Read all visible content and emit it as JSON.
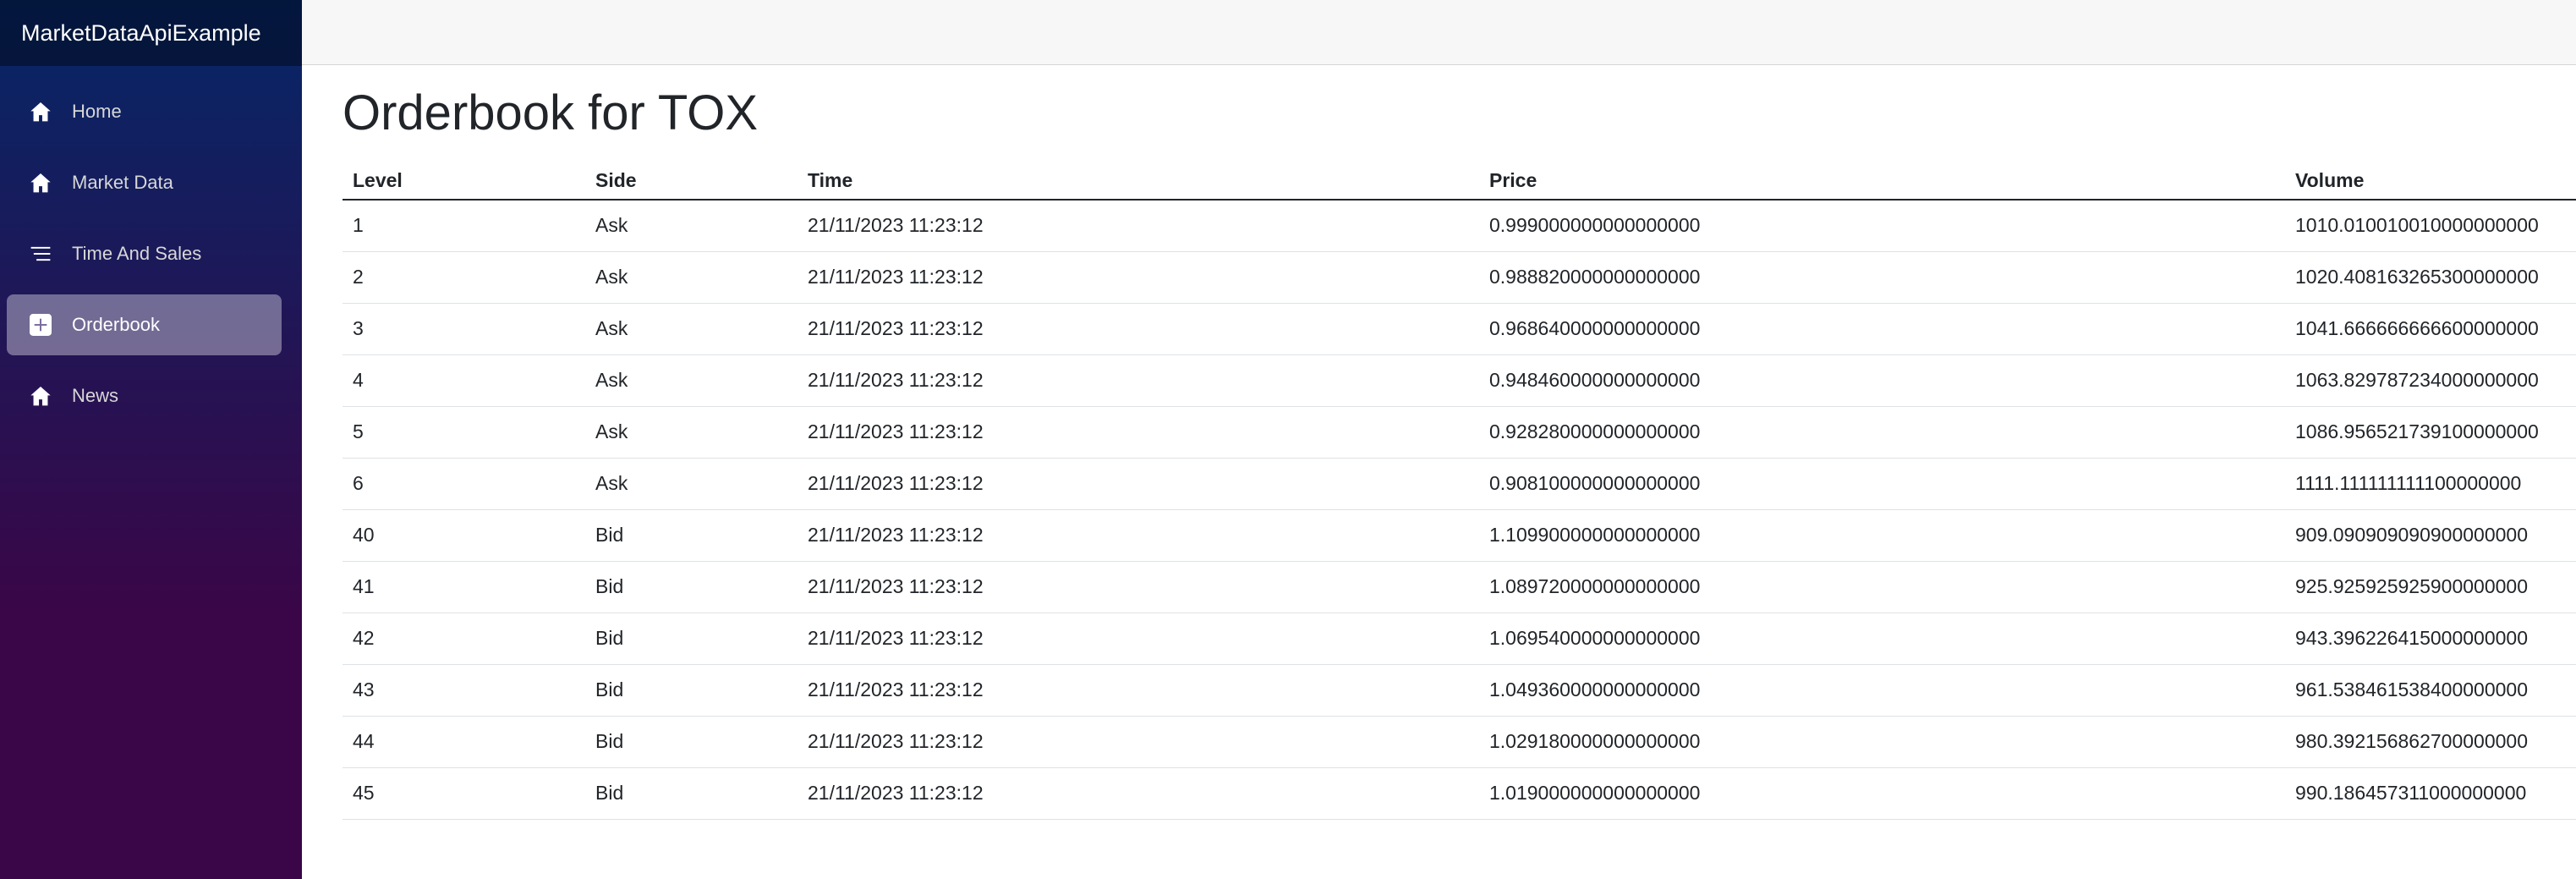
{
  "app": {
    "brand": "MarketDataApiExample"
  },
  "nav": {
    "items": [
      {
        "label": "Home",
        "icon": "home-icon",
        "active": false
      },
      {
        "label": "Market Data",
        "icon": "home-icon",
        "active": false
      },
      {
        "label": "Time And Sales",
        "icon": "list-icon",
        "active": false
      },
      {
        "label": "Orderbook",
        "icon": "plus-square-icon",
        "active": true
      },
      {
        "label": "News",
        "icon": "home-icon",
        "active": false
      }
    ]
  },
  "page": {
    "title": "Orderbook for TOX"
  },
  "table": {
    "columns": [
      "Level",
      "Side",
      "Time",
      "Price",
      "Volume"
    ],
    "rows": [
      [
        "1",
        "Ask",
        "21/11/2023 11:23:12",
        "0.999000000000000000",
        "1010.010010010000000000"
      ],
      [
        "2",
        "Ask",
        "21/11/2023 11:23:12",
        "0.988820000000000000",
        "1020.408163265300000000"
      ],
      [
        "3",
        "Ask",
        "21/11/2023 11:23:12",
        "0.968640000000000000",
        "1041.666666666600000000"
      ],
      [
        "4",
        "Ask",
        "21/11/2023 11:23:12",
        "0.948460000000000000",
        "1063.829787234000000000"
      ],
      [
        "5",
        "Ask",
        "21/11/2023 11:23:12",
        "0.928280000000000000",
        "1086.956521739100000000"
      ],
      [
        "6",
        "Ask",
        "21/11/2023 11:23:12",
        "0.908100000000000000",
        "1111.111111111100000000"
      ],
      [
        "40",
        "Bid",
        "21/11/2023 11:23:12",
        "1.109900000000000000",
        "909.090909090900000000"
      ],
      [
        "41",
        "Bid",
        "21/11/2023 11:23:12",
        "1.089720000000000000",
        "925.925925925900000000"
      ],
      [
        "42",
        "Bid",
        "21/11/2023 11:23:12",
        "1.069540000000000000",
        "943.396226415000000000"
      ],
      [
        "43",
        "Bid",
        "21/11/2023 11:23:12",
        "1.049360000000000000",
        "961.538461538400000000"
      ],
      [
        "44",
        "Bid",
        "21/11/2023 11:23:12",
        "1.029180000000000000",
        "980.392156862700000000"
      ],
      [
        "45",
        "Bid",
        "21/11/2023 11:23:12",
        "1.019000000000000000",
        "990.186457311000000000"
      ]
    ]
  },
  "colors": {
    "sidebar_gradient_top": "#052767",
    "sidebar_gradient_bottom": "#3a0647",
    "active_nav_bg": "rgba(255,255,255,0.37)",
    "top_row_bg": "#f7f7f7",
    "text": "#212529"
  }
}
